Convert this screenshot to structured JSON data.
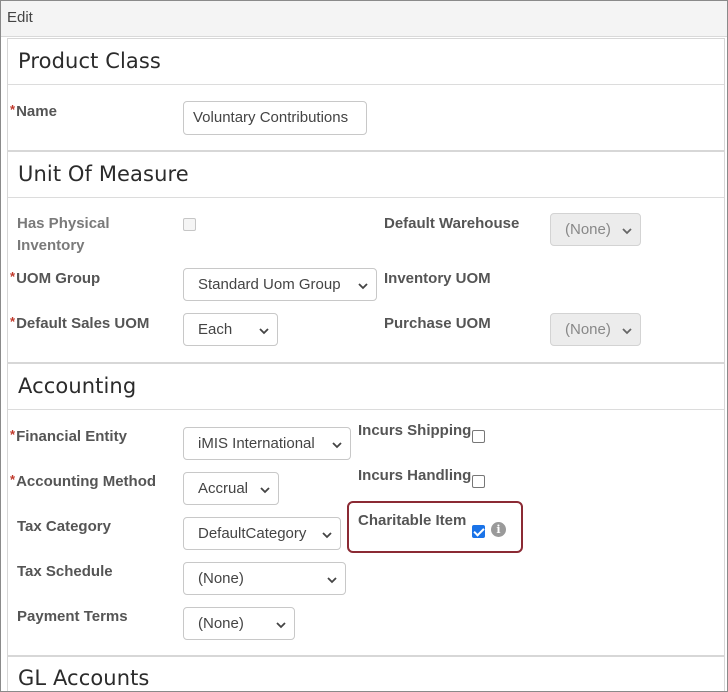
{
  "header": {
    "title": "Edit"
  },
  "product_class": {
    "title": "Product Class",
    "name_label": "Name",
    "name_value": "Voluntary Contributions",
    "required_mark": "*"
  },
  "unit_of_measure": {
    "title": "Unit Of Measure",
    "has_physical_inventory_label": "Has Physical Inventory",
    "has_physical_inventory_checked": false,
    "default_warehouse_label": "Default Warehouse",
    "default_warehouse_value": "(None)",
    "uom_group_label": "UOM Group",
    "uom_group_value": "Standard Uom Group",
    "inventory_uom_label": "Inventory UOM",
    "default_sales_uom_label": "Default Sales UOM",
    "default_sales_uom_value": "Each",
    "purchase_uom_label": "Purchase UOM",
    "purchase_uom_value": "(None)"
  },
  "accounting": {
    "title": "Accounting",
    "financial_entity_label": "Financial Entity",
    "financial_entity_value": "iMIS International",
    "incurs_shipping_label": "Incurs Shipping",
    "incurs_shipping_checked": false,
    "accounting_method_label": "Accounting Method",
    "accounting_method_value": "Accrual",
    "incurs_handling_label": "Incurs Handling",
    "incurs_handling_checked": false,
    "tax_category_label": "Tax Category",
    "tax_category_value": "DefaultCategory",
    "charitable_item_label": "Charitable Item",
    "charitable_item_checked": true,
    "info_glyph": "i",
    "tax_schedule_label": "Tax Schedule",
    "tax_schedule_value": "(None)",
    "payment_terms_label": "Payment Terms",
    "payment_terms_value": "(None)"
  },
  "gl_accounts": {
    "title": "GL Accounts"
  },
  "colors": {
    "required": "#c0392b",
    "highlight": "#8b2a34",
    "checkbox_checked": "#1a73e8"
  }
}
